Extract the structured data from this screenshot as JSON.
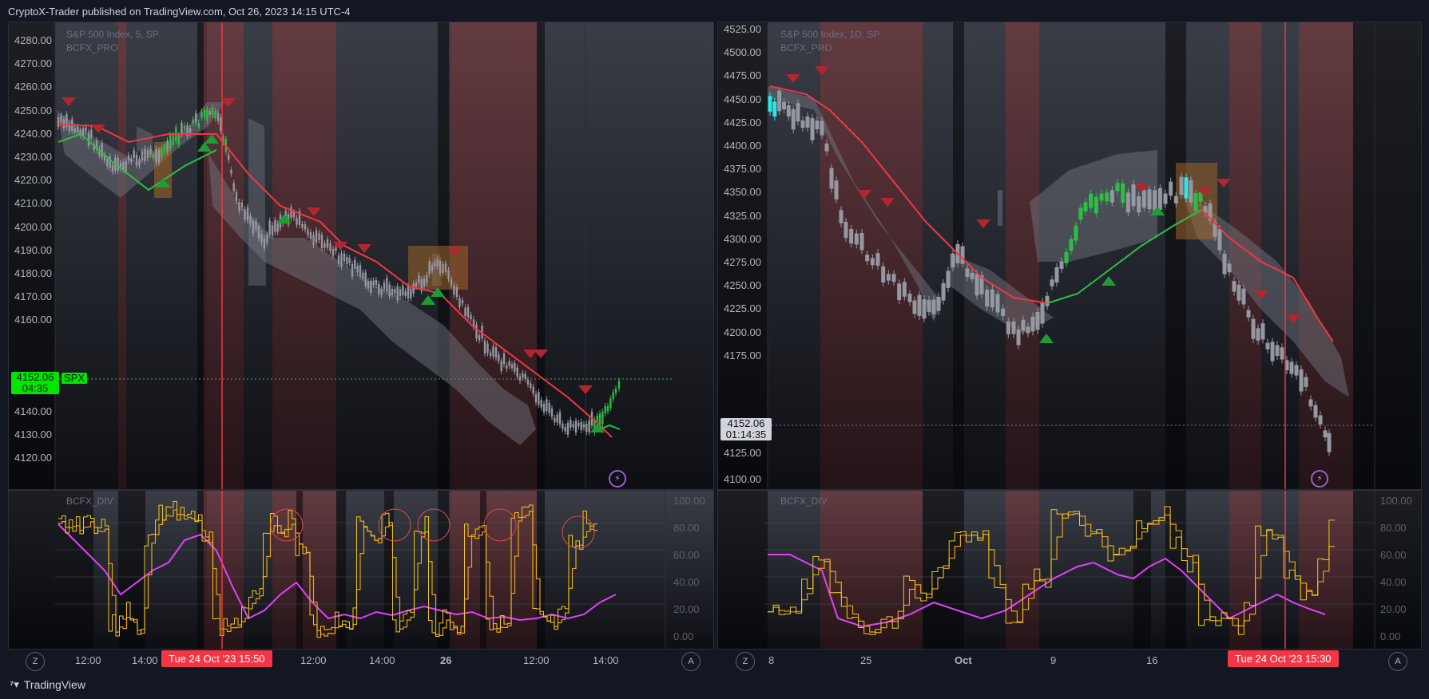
{
  "header": {
    "published_by": "CryptoX-Trader published on TradingView.com, Oct 26, 2023 14:15 UTC-4"
  },
  "left_chart": {
    "symbol_title": "S&P 500 Index, 5, SP",
    "indicator_title": "BCFX_PRO",
    "osc_title": "BCFX_DIV",
    "price_axis": [
      "4280.00",
      "4270.00",
      "4260.00",
      "4250.00",
      "4240.00",
      "4230.00",
      "4220.00",
      "4210.00",
      "4200.00",
      "4190.00",
      "4180.00",
      "4170.00",
      "4160.00",
      "4140.00",
      "4130.00",
      "4120.00"
    ],
    "last_price": "4152.06",
    "countdown": "04:35",
    "symbol_tag": "SPX",
    "osc_axis": [
      "100.00",
      "80.00",
      "60.00",
      "40.00",
      "20.00",
      "0.00"
    ],
    "time_axis": [
      "12:00",
      "14:00",
      "12:00",
      "14:00",
      "26",
      "12:00",
      "14:00"
    ],
    "crosshair_label": "Tue 24 Oct '23   15:50",
    "zoom_btn": "Z",
    "auto_btn": "A"
  },
  "right_chart": {
    "symbol_title": "S&P 500 Index, 1D, SP",
    "indicator_title": "BCFX_PRO",
    "osc_title": "BCFX_DIV",
    "price_axis": [
      "4525.00",
      "4500.00",
      "4475.00",
      "4450.00",
      "4425.00",
      "4400.00",
      "4375.00",
      "4350.00",
      "4325.00",
      "4300.00",
      "4275.00",
      "4250.00",
      "4225.00",
      "4200.00",
      "4175.00",
      "4125.00",
      "4100.00"
    ],
    "last_price": "4152.06",
    "countdown": "01:14:35",
    "osc_axis": [
      "100.00",
      "80.00",
      "60.00",
      "40.00",
      "20.00",
      "0.00"
    ],
    "time_axis": [
      "8",
      "25",
      "Oct",
      "9",
      "16"
    ],
    "crosshair_label": "Tue 24 Oct '23   15:30",
    "zoom_btn": "Z",
    "auto_btn": "A"
  },
  "footer": {
    "brand": "TradingView"
  },
  "colors": {
    "bull": "#2ebd45",
    "bear": "#f23645",
    "band": "#787b86",
    "osc_k": "#f5c518",
    "osc_d": "#e040fb",
    "accent": "#2962ff"
  }
}
